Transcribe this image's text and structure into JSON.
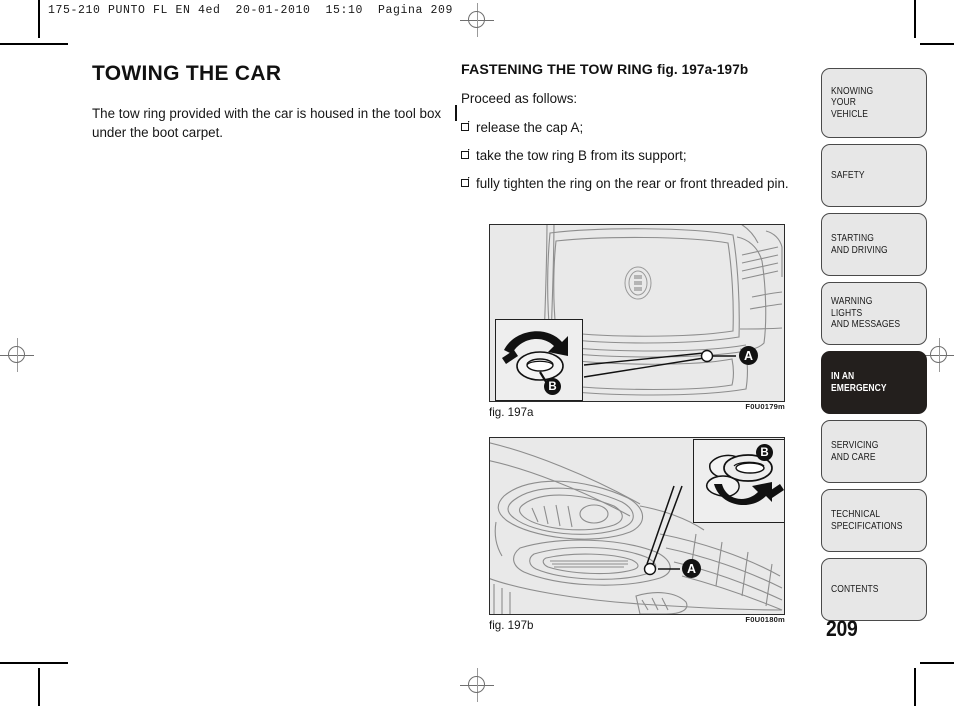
{
  "print_header": "175-210 PUNTO FL EN 4ed  20-01-2010  15:10  Pagina 209",
  "left_column": {
    "title": "TOWING THE CAR",
    "paragraph": "The tow ring provided with the car is housed in the tool box under the boot carpet."
  },
  "right_column": {
    "subtitle_main": "FASTENING THE TOW RING",
    "subtitle_figref": "fig. 197a-197b",
    "lead": "Proceed as follows:",
    "steps": [
      "release the cap A;",
      "take the tow ring B from its support;",
      "fully tighten the ring on the rear or front threaded pin."
    ]
  },
  "figures": [
    {
      "caption": "fig. 197a",
      "code": "F0U0179m",
      "callout_main": "A",
      "callout_inset": "B"
    },
    {
      "caption": "fig. 197b",
      "code": "F0U0180m",
      "callout_main": "A",
      "callout_inset": "B"
    }
  ],
  "sidebar": {
    "tabs": [
      {
        "label": "KNOWING\nYOUR\nVEHICLE",
        "active": false,
        "height": 70
      },
      {
        "label": "SAFETY",
        "active": false,
        "height": 63
      },
      {
        "label": "STARTING\nAND DRIVING",
        "active": false,
        "height": 63
      },
      {
        "label": "WARNING LIGHTS\nAND MESSAGES",
        "active": false,
        "height": 63
      },
      {
        "label": "IN AN\nEMERGENCY",
        "active": true,
        "height": 63
      },
      {
        "label": "SERVICING\nAND CARE",
        "active": false,
        "height": 63
      },
      {
        "label": "TECHNICAL\nSPECIFICATIONS",
        "active": false,
        "height": 63
      },
      {
        "label": "CONTENTS",
        "active": false,
        "height": 63
      }
    ],
    "active_color": "#231f1d",
    "inactive_color": "#e7e7e7"
  },
  "page_number": "209"
}
